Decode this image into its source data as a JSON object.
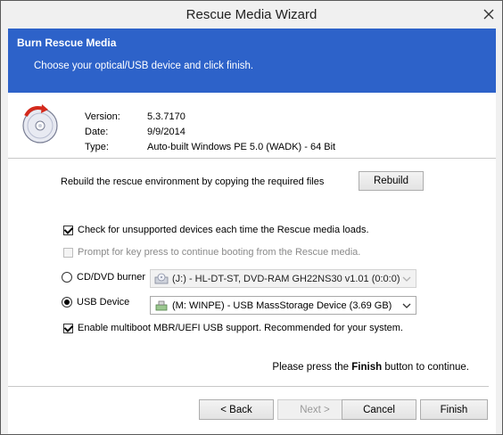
{
  "window": {
    "title": "Rescue Media Wizard",
    "close_icon": "close-icon"
  },
  "header": {
    "title": "Burn Rescue Media",
    "subtitle": "Choose your optical/USB device and click finish."
  },
  "info": {
    "version_label": "Version:",
    "version_value": "5.3.7170",
    "date_label": "Date:",
    "date_value": "9/9/2014",
    "type_label": "Type:",
    "type_value": "Auto-built Windows PE 5.0 (WADK) - 64 Bit"
  },
  "rebuild": {
    "text": "Rebuild the rescue environment by copying the required files",
    "button": "Rebuild"
  },
  "options": {
    "check_unsupported": {
      "label": "Check for unsupported devices each time the Rescue media loads.",
      "checked": true
    },
    "prompt_key": {
      "label": "Prompt for key press to continue booting from the Rescue media.",
      "checked": false,
      "enabled": false
    },
    "multiboot": {
      "label": "Enable multiboot MBR/UEFI USB support. Recommended for your system.",
      "checked": true
    }
  },
  "devices": {
    "cd": {
      "label": "CD/DVD burner",
      "selected": false,
      "value": "(J:) - HL-DT-ST, DVD-RAM GH22NS30 v1.01 (0:0:0)"
    },
    "usb": {
      "label": "USB Device",
      "selected": true,
      "value": "(M: WINPE) - USB MassStorage Device (3.69 GB)"
    }
  },
  "hint": {
    "prefix": "Please press the",
    "bold": "Finish",
    "suffix": "button to continue."
  },
  "buttons": {
    "back": "< Back",
    "next": "Next >",
    "cancel": "Cancel",
    "finish": "Finish"
  },
  "colors": {
    "header_bg": "#2d62c9"
  }
}
